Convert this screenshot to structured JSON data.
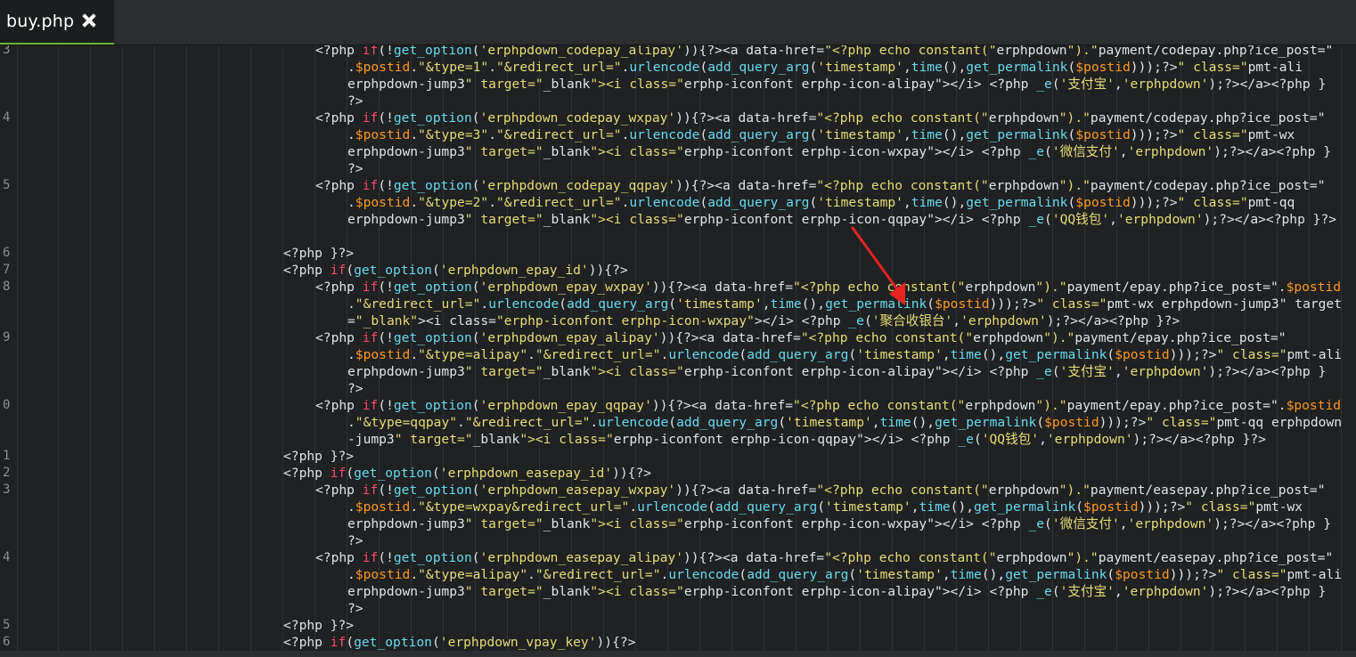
{
  "tab": {
    "title": "buy.php"
  },
  "line_numbers": [
    "3",
    "4",
    "5",
    "6",
    "7",
    "8",
    "9",
    "0",
    "1",
    "2",
    "3",
    "4",
    "5",
    "6"
  ],
  "code_lines": [
    "<?php if(!get_option('erphpdown_codepay_alipay')){?><a data-href=\"<?php echo constant(\"erphpdown\").\"payment/codepay.php?ice_post=\"",
    ".$postid.\"&type=1\".\"&redirect_url=\".urlencode(add_query_arg('timestamp',time(),get_permalink($postid)));?>\" class=\"pmt-ali",
    "erphpdown-jump3\" target=\"_blank\"><i class=\"erphp-iconfont erphp-icon-alipay\"></i> <?php _e('支付宝','erphpdown');?></a><?php }",
    "?>",
    "<?php if(!get_option('erphpdown_codepay_wxpay')){?><a data-href=\"<?php echo constant(\"erphpdown\").\"payment/codepay.php?ice_post=\"",
    ".$postid.\"&type=3\".\"&redirect_url=\".urlencode(add_query_arg('timestamp',time(),get_permalink($postid)));?>\" class=\"pmt-wx",
    "erphpdown-jump3\" target=\"_blank\"><i class=\"erphp-iconfont erphp-icon-wxpay\"></i> <?php _e('微信支付','erphpdown');?></a><?php }",
    "?>",
    "<?php if(!get_option('erphpdown_codepay_qqpay')){?><a data-href=\"<?php echo constant(\"erphpdown\").\"payment/codepay.php?ice_post=\"",
    ".$postid.\"&type=2\".\"&redirect_url=\".urlencode(add_query_arg('timestamp',time(),get_permalink($postid)));?>\" class=\"pmt-qq",
    "erphpdown-jump3\" target=\"_blank\"><i class=\"erphp-iconfont erphp-icon-qqpay\"></i> <?php _e('QQ钱包','erphpdown');?></a><?php }?>",
    "",
    "<?php }?>",
    "<?php if(get_option('erphpdown_epay_id')){?>",
    "<?php if(!get_option('erphpdown_epay_wxpay')){?><a data-href=\"<?php echo constant(\"erphpdown\").\"payment/epay.php?ice_post=\".$postid",
    ".\"&redirect_url=\".urlencode(add_query_arg('timestamp',time(),get_permalink($postid)));?>\" class=\"pmt-wx erphpdown-jump3\" target",
    "=\"_blank\"><i class=\"erphp-iconfont erphp-icon-wxpay\"></i> <?php _e('聚合收银台','erphpdown');?></a><?php }?>",
    "<?php if(!get_option('erphpdown_epay_alipay')){?><a data-href=\"<?php echo constant(\"erphpdown\").\"payment/epay.php?ice_post=\"",
    ".$postid.\"&type=alipay\".\"&redirect_url=\".urlencode(add_query_arg('timestamp',time(),get_permalink($postid)));?>\" class=\"pmt-ali",
    "erphpdown-jump3\" target=\"_blank\"><i class=\"erphp-iconfont erphp-icon-alipay\"></i> <?php _e('支付宝','erphpdown');?></a><?php }",
    "?>",
    "<?php if(!get_option('erphpdown_epay_qqpay')){?><a data-href=\"<?php echo constant(\"erphpdown\").\"payment/epay.php?ice_post=\".$postid",
    ".\"&type=qqpay\".\"&redirect_url=\".urlencode(add_query_arg('timestamp',time(),get_permalink($postid)));?>\" class=\"pmt-qq erphpdown",
    "-jump3\" target=\"_blank\"><i class=\"erphp-iconfont erphp-icon-qqpay\"></i> <?php _e('QQ钱包','erphpdown');?></a><?php }?>",
    "<?php }?>",
    "<?php if(get_option('erphpdown_easepay_id')){?>",
    "<?php if(!get_option('erphpdown_easepay_wxpay')){?><a data-href=\"<?php echo constant(\"erphpdown\").\"payment/easepay.php?ice_post=\"",
    ".$postid.\"&type=wxpay&redirect_url=\".urlencode(add_query_arg('timestamp',time(),get_permalink($postid)));?>\" class=\"pmt-wx",
    "erphpdown-jump3\" target=\"_blank\"><i class=\"erphp-iconfont erphp-icon-wxpay\"></i> <?php _e('微信支付','erphpdown');?></a><?php }",
    "?>",
    "<?php if(!get_option('erphpdown_easepay_alipay')){?><a data-href=\"<?php echo constant(\"erphpdown\").\"payment/easepay.php?ice_post=\"",
    ".$postid.\"&type=alipay\".\"&redirect_url=\".urlencode(add_query_arg('timestamp',time(),get_permalink($postid)));?>\" class=\"pmt-ali",
    "erphpdown-jump3\" target=\"_blank\"><i class=\"erphp-iconfont erphp-icon-alipay\"></i> <?php _e('支付宝','erphpdown');?></a><?php }",
    "?>",
    "<?php }?>",
    "<?php if(get_option('erphpdown_vpay_key')){?>"
  ],
  "colors": {
    "background": "#1f2122",
    "tab_active": "#1b1d1e",
    "tab_underline": "#6fb33c",
    "keyword": "#ff4a6a",
    "function": "#66d9ef",
    "string": "#e6db74",
    "variable": "#fd971f",
    "default": "#e0e2e4",
    "annotation_arrow": "#e8231f"
  },
  "annotation": {
    "shape": "arrow",
    "icon": "red-arrow-icon"
  }
}
